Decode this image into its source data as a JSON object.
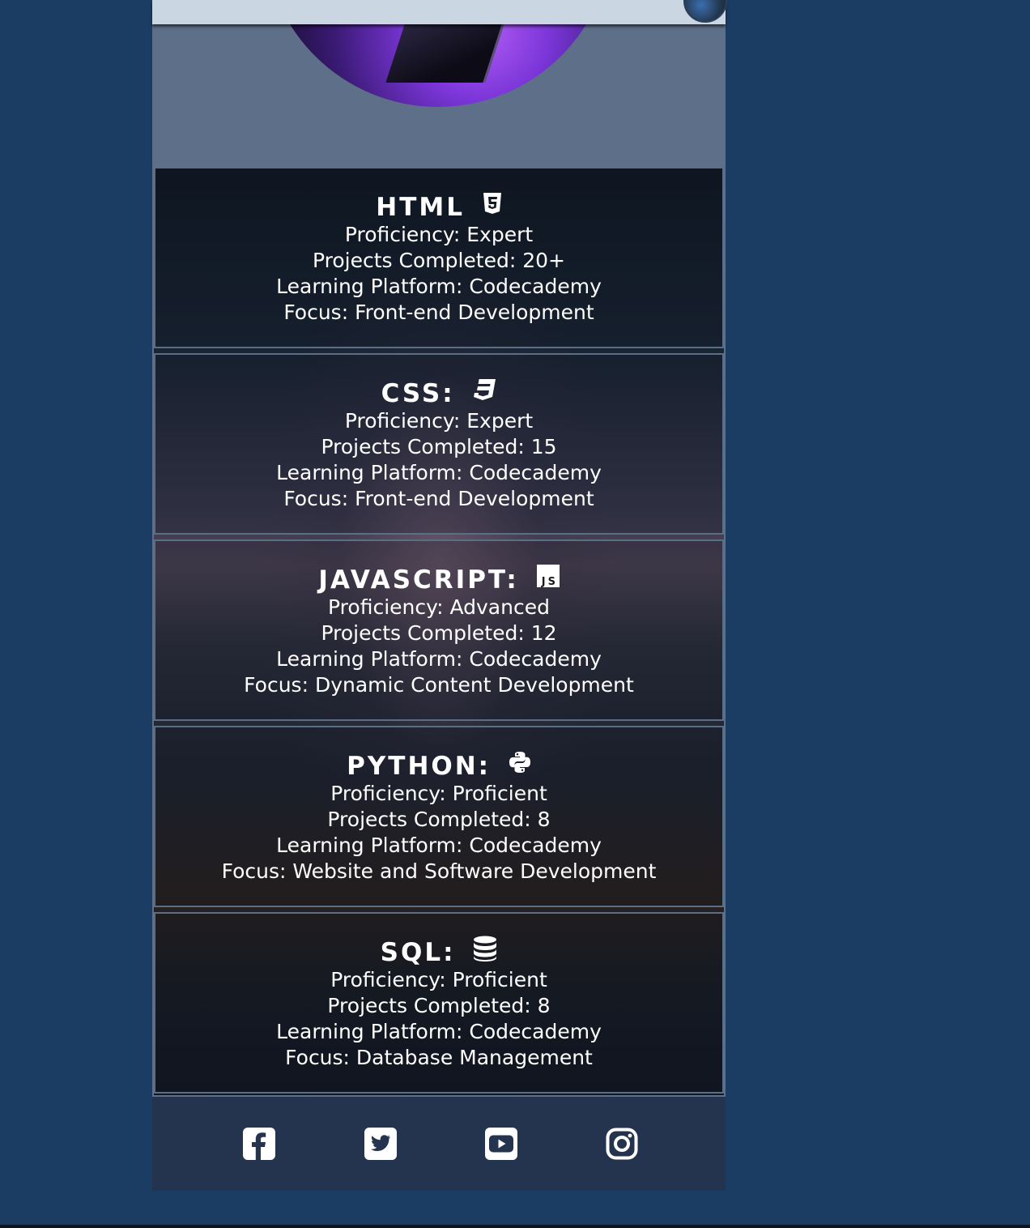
{
  "skills": [
    {
      "title": "HTML",
      "icon": "html5-icon",
      "proficiency": "Proficiency: Expert",
      "projects": "Projects Completed: 20+",
      "platform": "Learning Platform: Codecademy",
      "focus": "Focus: Front-end Development"
    },
    {
      "title": "CSS:",
      "icon": "css3-icon",
      "proficiency": "Proficiency: Expert",
      "projects": "Projects Completed: 15",
      "platform": "Learning Platform: Codecademy",
      "focus": "Focus: Front-end Development"
    },
    {
      "title": "JAVASCRIPT:",
      "icon": "js-icon",
      "icon_text": "JS",
      "proficiency": "Proficiency: Advanced",
      "projects": "Projects Completed: 12",
      "platform": "Learning Platform: Codecademy",
      "focus": "Focus: Dynamic Content Development"
    },
    {
      "title": "PYTHON:",
      "icon": "python-icon",
      "proficiency": "Proficiency: Proficient",
      "projects": "Projects Completed: 8",
      "platform": "Learning Platform: Codecademy",
      "focus": "Focus: Website and Software Development"
    },
    {
      "title": "SQL:",
      "icon": "database-icon",
      "proficiency": "Proficiency: Proficient",
      "projects": "Projects Completed: 8",
      "platform": "Learning Platform: Codecademy",
      "focus": "Focus: Database Management"
    }
  ],
  "social": [
    {
      "icon": "facebook-icon"
    },
    {
      "icon": "twitter-icon"
    },
    {
      "icon": "youtube-icon"
    },
    {
      "icon": "instagram-icon"
    }
  ],
  "colors": {
    "page_background": "#1b3d63",
    "column_background": "#5e7089",
    "header_bar": "#cad7e3",
    "social_bar": "#24344e",
    "card_border": "#5a6e86",
    "text": "#ffffff"
  }
}
